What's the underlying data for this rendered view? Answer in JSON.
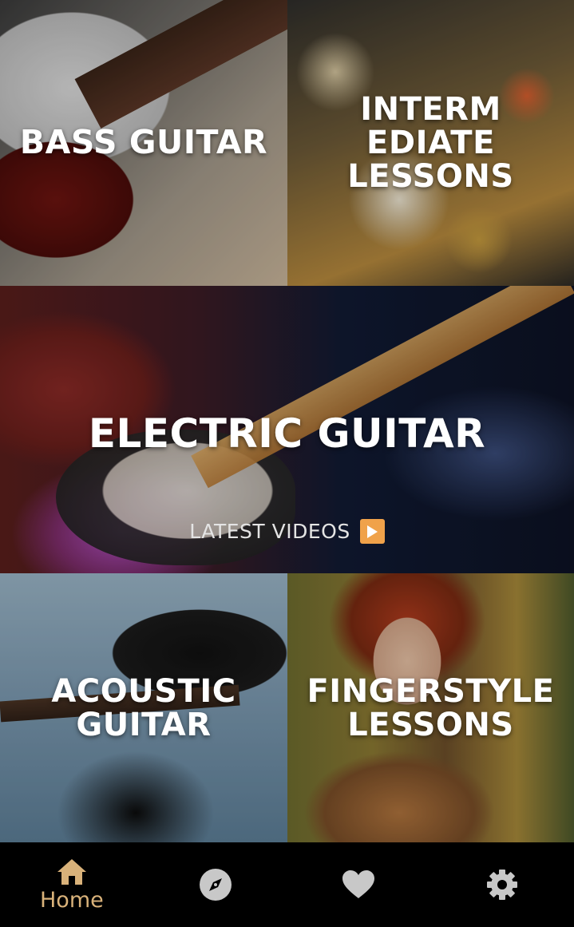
{
  "tiles": {
    "bass": {
      "label": "BASS GUITAR"
    },
    "intermediate": {
      "label": "INTERM\nEDIATE\nLESSONS"
    },
    "electric": {
      "label": "ELECTRIC GUITAR",
      "subtitle": "LATEST VIDEOS"
    },
    "acoustic": {
      "label": "ACOUSTIC\nGUITAR"
    },
    "fingerstyle": {
      "label": "FINGERSTYLE\nLESSONS"
    }
  },
  "nav": {
    "items": [
      {
        "icon": "home-icon",
        "label": "Home",
        "active": true
      },
      {
        "icon": "compass-icon",
        "label": "",
        "active": false
      },
      {
        "icon": "heart-icon",
        "label": "",
        "active": false
      },
      {
        "icon": "gear-icon",
        "label": "",
        "active": false
      }
    ],
    "active_color": "#d9b27a",
    "inactive_color": "#c8c8c8"
  },
  "colors": {
    "play_badge": "#f0a24a",
    "background": "#000000"
  }
}
